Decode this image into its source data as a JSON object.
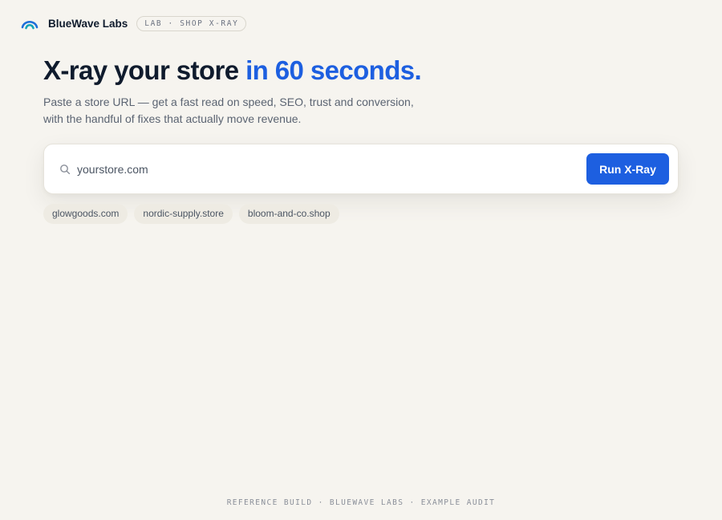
{
  "brand": {
    "icon": "wave-logo-icon",
    "name": "BlueWave Labs",
    "tag": "LAB · SHOP X-RAY"
  },
  "hero": {
    "headline_main": "X-ray your store ",
    "headline_accent": "in 60 seconds.",
    "subtitle_line1": "Paste a store URL — get a fast read on speed, SEO, trust and conversion,",
    "subtitle_line2": "with the handful of fixes that actually move revenue."
  },
  "search": {
    "icon": "search-icon",
    "placeholder": "yourstore.com",
    "value": "",
    "button_label": "Run X-Ray"
  },
  "suggestions": [
    "glowgoods.com",
    "nordic-supply.store",
    "bloom-and-co.shop"
  ],
  "footer": {
    "text": "REFERENCE BUILD · BLUEWAVE LABS · EXAMPLE AUDIT"
  },
  "colors": {
    "background": "#f6f4ef",
    "accent": "#1d5fe0",
    "heading": "#0f1b2d"
  }
}
